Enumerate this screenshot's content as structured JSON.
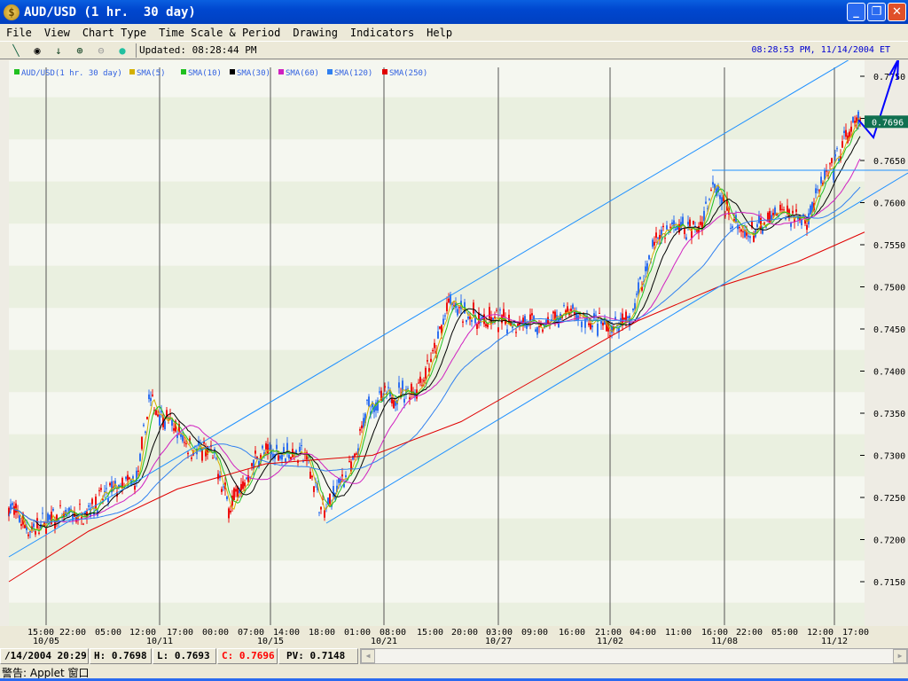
{
  "window": {
    "title": "AUD/USD (1 hr.  30 day)",
    "minimize": "_",
    "restore": "❐",
    "close": "✕"
  },
  "menu": [
    "File",
    "View",
    "Chart Type",
    "Time Scale & Period",
    "Drawing",
    "Indicators",
    "Help"
  ],
  "toolbar": {
    "icons": [
      "line-tool-icon",
      "target-icon",
      "arrow-down-icon",
      "zoom-in-icon",
      "zoom-out-icon",
      "globe-icon"
    ],
    "updated": "Updated: 08:28:44 PM",
    "clock": "08:28:53 PM, 11/14/2004 ET"
  },
  "legend": [
    {
      "label": "AUD/USD(1 hr.  30 day)",
      "color": "#20c020"
    },
    {
      "label": "SMA(5)",
      "color": "#d4b000"
    },
    {
      "label": "SMA(10)",
      "color": "#20c020"
    },
    {
      "label": "SMA(30)",
      "color": "#000000"
    },
    {
      "label": "SMA(60)",
      "color": "#d020c0"
    },
    {
      "label": "SMA(120)",
      "color": "#3080f0"
    },
    {
      "label": "SMA(250)",
      "color": "#e00000"
    }
  ],
  "chart_data": {
    "type": "candlestick",
    "y_ticks": [
      "0.7750",
      "0.7700",
      "0.7650",
      "0.7600",
      "0.7550",
      "0.7500",
      "0.7450",
      "0.7400",
      "0.7350",
      "0.7300",
      "0.7250",
      "0.7200",
      "0.7150"
    ],
    "ylim": [
      0.714,
      0.7765
    ],
    "current_price": "0.7696",
    "time_labels": [
      "15:00",
      "22:00",
      "05:00",
      "12:00",
      "17:00",
      "00:00",
      "07:00",
      "14:00",
      "18:00",
      "01:00",
      "08:00",
      "15:00",
      "20:00",
      "03:00",
      "09:00",
      "16:00",
      "21:00",
      "04:00",
      "11:00",
      "16:00",
      "22:00",
      "05:00",
      "12:00",
      "17:00"
    ],
    "date_labels": [
      "10/05",
      "10/11",
      "10/15",
      "10/21",
      "10/27",
      "11/02",
      "11/08",
      "11/12"
    ],
    "approx_close_path": [
      0.724,
      0.721,
      0.7225,
      0.723,
      0.726,
      0.727,
      0.7365,
      0.734,
      0.731,
      0.73,
      0.724,
      0.7265,
      0.73,
      0.7305,
      0.73,
      0.723,
      0.727,
      0.729,
      0.736,
      0.737,
      0.738,
      0.742,
      0.748,
      0.747,
      0.746,
      0.746,
      0.746,
      0.745,
      0.747,
      0.746,
      0.745,
      0.746,
      0.751,
      0.756,
      0.757,
      0.757,
      0.763,
      0.759,
      0.756,
      0.757,
      0.759,
      0.758,
      0.762,
      0.764,
      0.768,
      0.7696
    ]
  },
  "status": {
    "datetime": "/14/2004 20:29:",
    "high": "H: 0.7698",
    "low": "L: 0.7693",
    "close": "C: 0.7696",
    "pv": "PV: 0.7148"
  },
  "warning": "警告: Applet 窗口",
  "colors": {
    "close": "#ff0000",
    "price_tag": "#107050",
    "trendline": "#1e90ff",
    "arrow": "#0000ff"
  }
}
